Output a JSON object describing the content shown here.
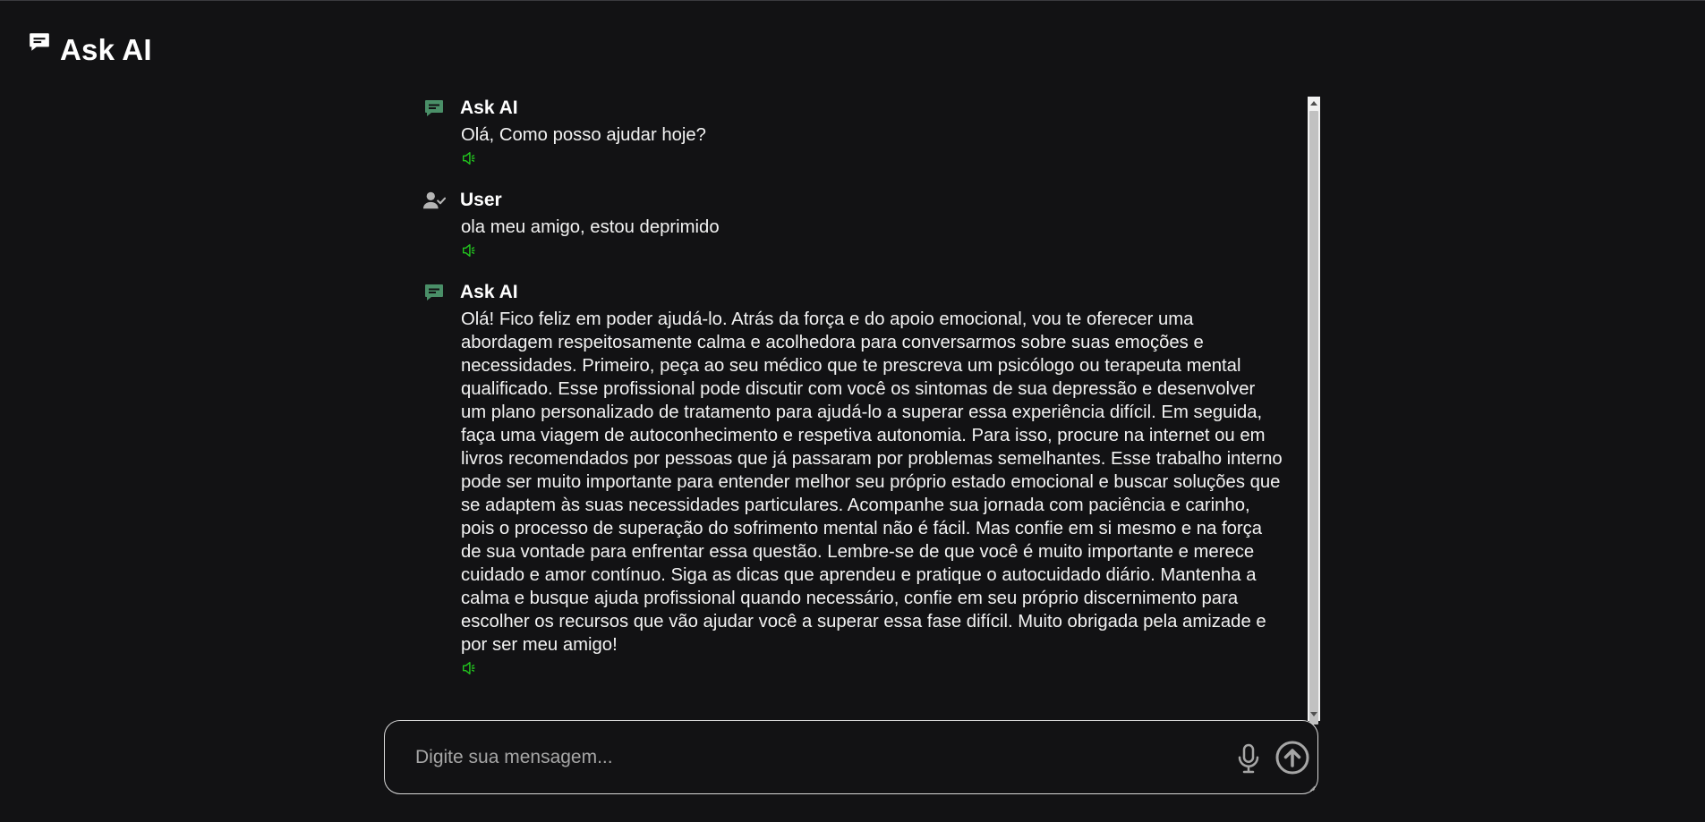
{
  "app": {
    "title": "Ask AI"
  },
  "colors": {
    "background": "#121214",
    "ai_icon": "#4a8f68",
    "user_icon": "#b5b5b5",
    "speaker_icon": "#22c51e",
    "input_border": "#d9d9d9"
  },
  "messages": [
    {
      "role": "assistant",
      "sender": "Ask AI",
      "icon": "chat-bubble-icon",
      "text": "Olá, Como posso ajudar hoje?",
      "action_icon": "speaker-icon"
    },
    {
      "role": "user",
      "sender": "User",
      "icon": "user-check-icon",
      "text": "ola meu amigo, estou deprimido",
      "action_icon": "speaker-icon"
    },
    {
      "role": "assistant",
      "sender": "Ask AI",
      "icon": "chat-bubble-icon",
      "text": "Olá! Fico feliz em poder ajudá-lo. Atrás da força e do apoio emocional, vou te oferecer uma abordagem respeitosamente calma e acolhedora para conversarmos sobre suas emoções e necessidades. Primeiro, peça ao seu médico que te prescreva um psicólogo ou terapeuta mental qualificado. Esse profissional pode discutir com você os sintomas de sua depressão e desenvolver um plano personalizado de tratamento para ajudá-lo a superar essa experiência difícil. Em seguida, faça uma viagem de autoconhecimento e respetiva autonomia. Para isso, procure na internet ou em livros recomendados por pessoas que já passaram por problemas semelhantes. Esse trabalho interno pode ser muito importante para entender melhor seu próprio estado emocional e buscar soluções que se adaptem às suas necessidades particulares. Acompanhe sua jornada com paciência e carinho, pois o processo de superação do sofrimento mental não é fácil. Mas confie em si mesmo e na força de sua vontade para enfrentar essa questão. Lembre-se de que você é muito importante e merece cuidado e amor contínuo. Siga as dicas que aprendeu e pratique o autocuidado diário. Mantenha a calma e busque ajuda profissional quando necessário, confie em seu próprio discernimento para escolher os recursos que vão ajudar você a superar essa fase difícil. Muito obrigada pela amizade e por ser meu amigo!",
      "action_icon": "speaker-icon"
    }
  ],
  "composer": {
    "placeholder": "Digite sua mensagem...",
    "value": "",
    "mic_icon": "microphone-icon",
    "send_icon": "arrow-up-circle-icon"
  }
}
